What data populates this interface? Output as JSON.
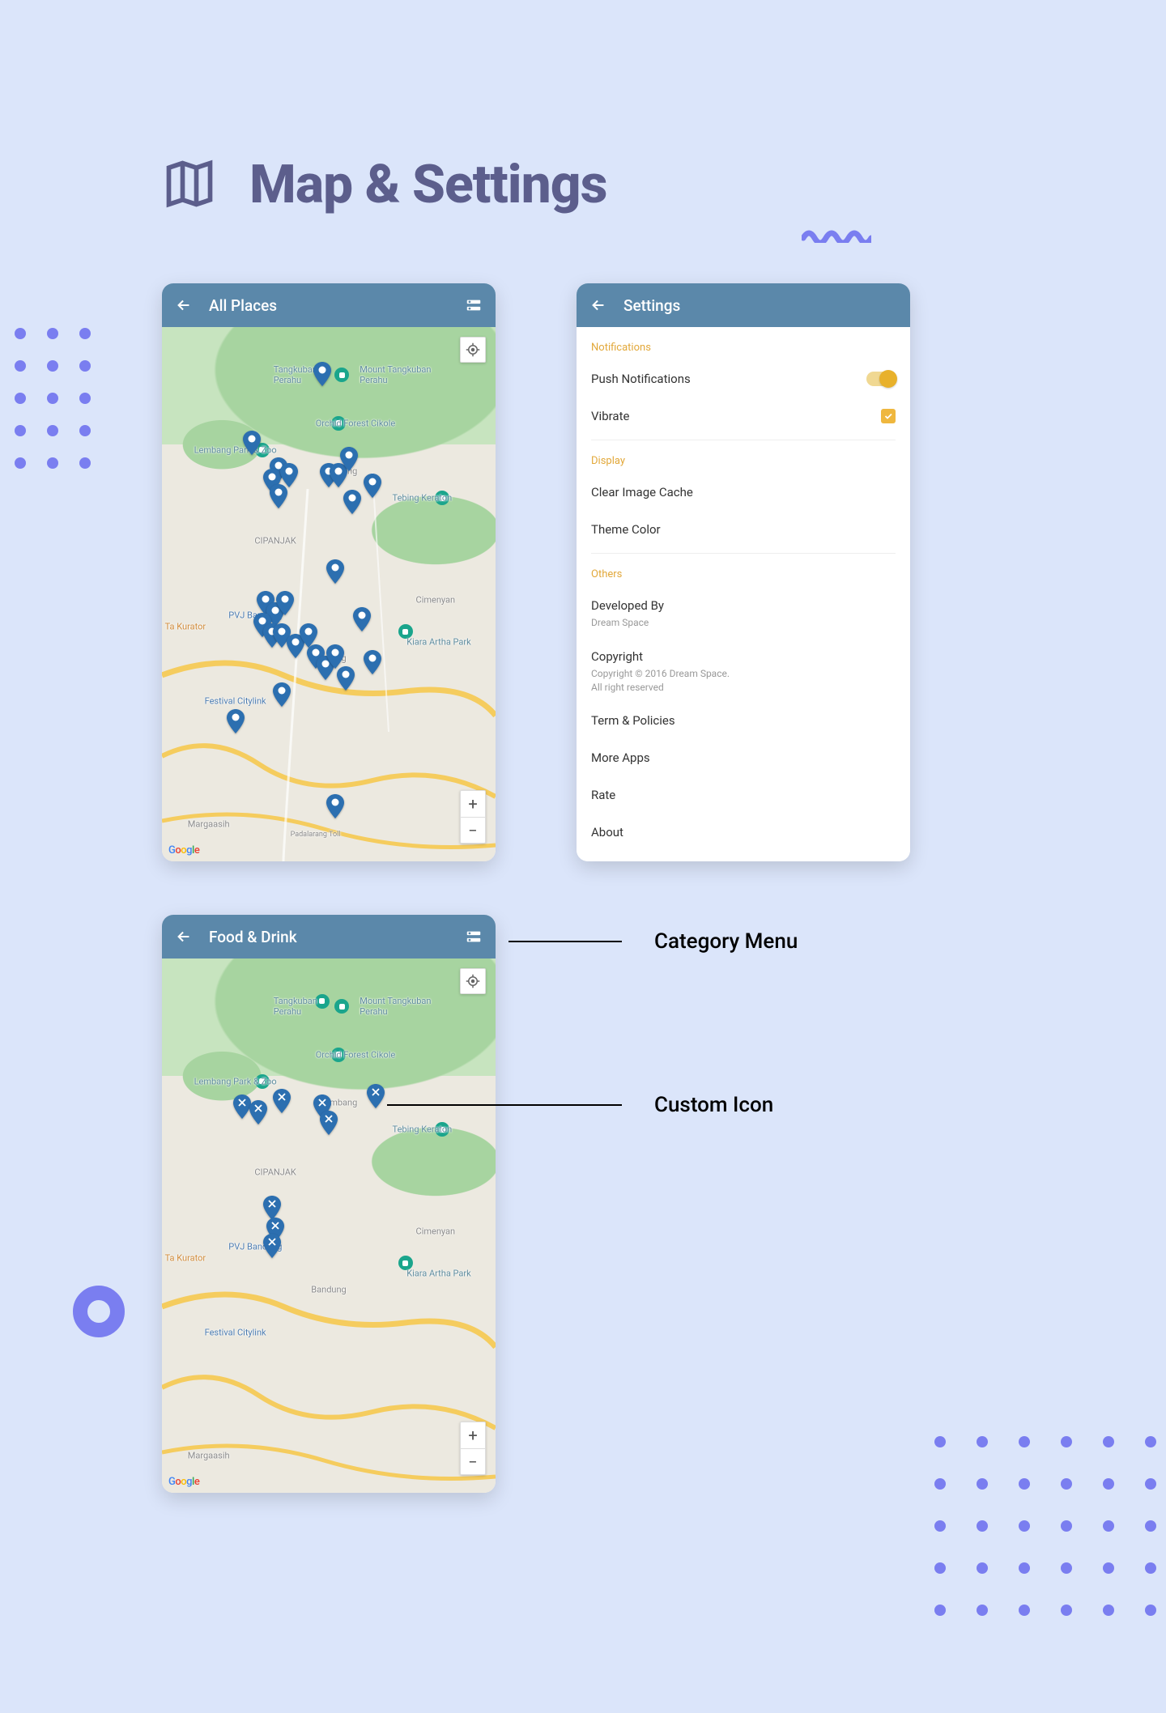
{
  "page": {
    "title": "Map & Settings"
  },
  "callouts": {
    "category_menu": "Category Menu",
    "custom_icon": "Custom Icon"
  },
  "screen_allplaces": {
    "app_bar_title": "All Places",
    "zoom_plus": "+",
    "zoom_minus": "−",
    "map_labels": {
      "tangkuban_perahu": "Tangkuban\nPerahu",
      "mount_tangkuban": "Mount Tangkuban\nPerahu",
      "orchid_forest": "Orchid Forest Cikole",
      "lembang_park": "Lembang Park & Zoo",
      "lembang": "Lembang",
      "tebing_keraton": "Tebing Keraton",
      "cipanjak": "CIPANJAK",
      "pvj_bandung": "PVJ Bandung",
      "cimenyan": "Cimenyan",
      "ta_kurator": "Ta Kurator",
      "bandung": "Bandung",
      "kiara_artha": "Kiara Artha Park",
      "festival_citylink": "Festival Citylink",
      "margaasih": "Margaasih",
      "padalarang": "Padalarang Toll"
    }
  },
  "screen_settings": {
    "app_bar_title": "Settings",
    "sections": {
      "notifications": "Notifications",
      "display": "Display",
      "others": "Others"
    },
    "items": {
      "push_notifications": "Push Notifications",
      "vibrate": "Vibrate",
      "clear_cache": "Clear Image Cache",
      "theme_color": "Theme Color",
      "developed_by": "Developed By",
      "developed_by_sub": "Dream Space",
      "copyright": "Copyright",
      "copyright_sub": "Copyright © 2016 Dream Space.\nAll right reserved",
      "term_policies": "Term & Policies",
      "more_apps": "More Apps",
      "rate": "Rate",
      "about": "About"
    }
  },
  "screen_food": {
    "app_bar_title": "Food & Drink",
    "zoom_plus": "+",
    "zoom_minus": "−"
  },
  "google_logo": {
    "g": "G",
    "o1": "o",
    "o2": "o",
    "gg": "g",
    "l": "l",
    "e": "e"
  }
}
